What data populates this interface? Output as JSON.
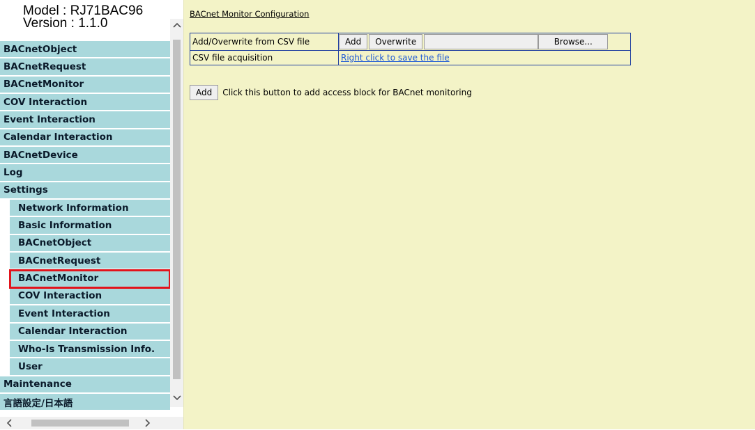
{
  "sidebar": {
    "model": "Model : RJ71BAC96",
    "version": "Version : 1.1.0",
    "items": [
      {
        "label": "BACnetObject"
      },
      {
        "label": "BACnetRequest"
      },
      {
        "label": "BACnetMonitor"
      },
      {
        "label": "COV Interaction"
      },
      {
        "label": "Event Interaction"
      },
      {
        "label": "Calendar Interaction"
      },
      {
        "label": "BACnetDevice"
      },
      {
        "label": "Log"
      },
      {
        "label": "Settings"
      }
    ],
    "settings_items": [
      {
        "label": "Network Information"
      },
      {
        "label": "Basic Information"
      },
      {
        "label": "BACnetObject"
      },
      {
        "label": "BACnetRequest"
      },
      {
        "label": "BACnetMonitor"
      },
      {
        "label": "COV Interaction"
      },
      {
        "label": "Event Interaction"
      },
      {
        "label": "Calendar Interaction"
      },
      {
        "label": "Who-Is Transmission Info."
      },
      {
        "label": "User"
      }
    ],
    "bottom_items": [
      {
        "label": "Maintenance"
      },
      {
        "label": "言語設定/日本語"
      }
    ],
    "selected_color": "#e2131b",
    "item_color": "#a9d8dc"
  },
  "main": {
    "title": "BACnet Monitor Configuration",
    "csv_row1_label": "Add/Overwrite from CSV file",
    "add_button": "Add",
    "overwrite_button": "Overwrite",
    "browse_button": "Browse...",
    "csv_row2_label": "CSV file acquisition",
    "csv_link": "Right click to save the file",
    "add_block_button": "Add",
    "add_block_text": "Click this button to add access block for BACnet monitoring",
    "background_color": "#f3f3c7"
  },
  "scrollbars": {
    "up_icon": "chevron-up-icon",
    "down_icon": "chevron-down-icon",
    "left_icon": "chevron-left-icon",
    "right_icon": "chevron-right-icon"
  }
}
